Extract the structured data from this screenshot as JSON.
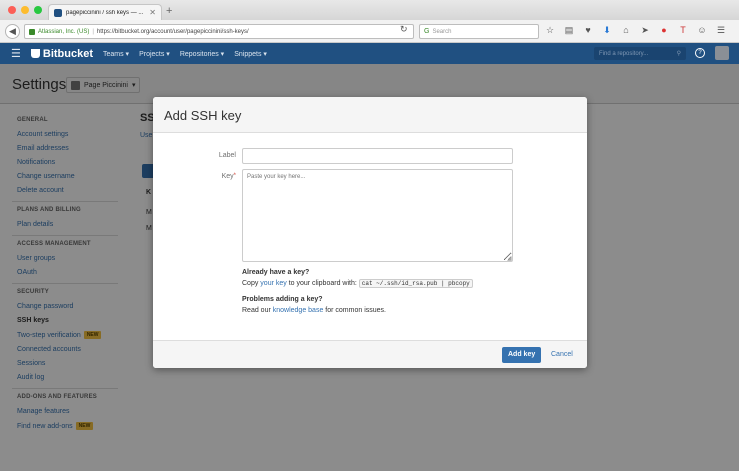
{
  "browser": {
    "tab_title": "pagepiccinini / ssh keys — ...",
    "url_org": "Atlassian, Inc. (US)",
    "url": "https://bitbucket.org/account/user/pagepiccinini/ssh-keys/",
    "search_placeholder": "Search"
  },
  "header": {
    "logo": "Bitbucket",
    "nav": [
      "Teams ▾",
      "Projects ▾",
      "Repositories ▾",
      "Snippets ▾"
    ],
    "find_placeholder": "Find a repository...",
    "help": "?"
  },
  "page": {
    "title": "Settings",
    "account": "Page Piccinini",
    "account_caret": "▾"
  },
  "sidebar": {
    "general": {
      "heading": "GENERAL",
      "items": [
        "Account settings",
        "Email addresses",
        "Notifications",
        "Change username",
        "Delete account"
      ]
    },
    "billing": {
      "heading": "PLANS AND BILLING",
      "items": [
        "Plan details"
      ]
    },
    "access": {
      "heading": "ACCESS MANAGEMENT",
      "items": [
        "User groups",
        "OAuth"
      ]
    },
    "security": {
      "heading": "SECURITY",
      "items": [
        "Change password",
        "SSH keys",
        "Two-step verification",
        "Connected accounts",
        "Sessions",
        "Audit log"
      ],
      "badge": "NEW"
    },
    "addons": {
      "heading": "ADD-ONS AND FEATURES",
      "items": [
        "Manage features",
        "Find new add-ons"
      ],
      "badge": "NEW"
    }
  },
  "content": {
    "title": "SS",
    "sub": "Use",
    "col": "K",
    "r1": "M",
    "r2": "M"
  },
  "dialog": {
    "title": "Add SSH key",
    "label_label": "Label",
    "key_label": "Key",
    "required_mark": "*",
    "key_placeholder": "Paste your key here...",
    "have_key_heading": "Already have a key?",
    "copy_prefix": "Copy ",
    "your_key_link": "your key",
    "copy_suffix": " to your clipboard with: ",
    "command": "cat ~/.ssh/id_rsa.pub | pbcopy",
    "problems_heading": "Problems adding a key?",
    "read_prefix": "Read our ",
    "kb_link": "knowledge base",
    "read_suffix": " for common issues.",
    "add_button": "Add key",
    "cancel": "Cancel"
  },
  "colors": {
    "brand": "#205081",
    "link": "#3572b0",
    "badge": "#f6c342"
  }
}
